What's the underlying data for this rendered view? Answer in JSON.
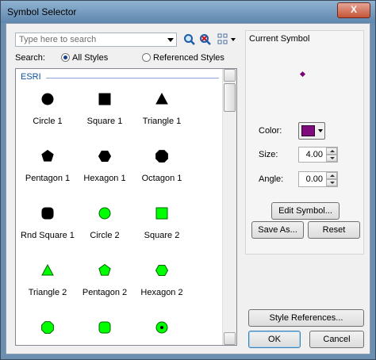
{
  "window": {
    "title": "Symbol Selector",
    "close_glyph": "X"
  },
  "search": {
    "placeholder": "Type here to search",
    "label": "Search:",
    "options": [
      "All Styles",
      "Referenced Styles"
    ],
    "selected": "All Styles"
  },
  "toolbar": {
    "icons": [
      "search-icon",
      "clear-search-icon",
      "view-options-icon"
    ]
  },
  "symbol_list": {
    "group": "ESRI",
    "symbols": [
      {
        "label": "Circle 1",
        "shape": "circle",
        "fill": "#000000"
      },
      {
        "label": "Square 1",
        "shape": "square",
        "fill": "#000000"
      },
      {
        "label": "Triangle 1",
        "shape": "triangle",
        "fill": "#000000"
      },
      {
        "label": "Pentagon 1",
        "shape": "pentagon",
        "fill": "#000000"
      },
      {
        "label": "Hexagon 1",
        "shape": "hexagon",
        "fill": "#000000"
      },
      {
        "label": "Octagon 1",
        "shape": "octagon",
        "fill": "#000000"
      },
      {
        "label": "Rnd Square 1",
        "shape": "rndsquare",
        "fill": "#000000"
      },
      {
        "label": "Circle 2",
        "shape": "circle",
        "fill": "#00ff00"
      },
      {
        "label": "Square 2",
        "shape": "square",
        "fill": "#00ff00"
      },
      {
        "label": "Triangle 2",
        "shape": "triangle",
        "fill": "#00ff00"
      },
      {
        "label": "Pentagon 2",
        "shape": "pentagon",
        "fill": "#00ff00"
      },
      {
        "label": "Hexagon 2",
        "shape": "hexagon",
        "fill": "#00ff00"
      },
      {
        "label": "",
        "shape": "octagon",
        "fill": "#00ff00"
      },
      {
        "label": "",
        "shape": "rndsquare",
        "fill": "#00ff00"
      },
      {
        "label": "",
        "shape": "targetcircle",
        "fill": "#00ff00"
      }
    ]
  },
  "current_symbol": {
    "title": "Current Symbol",
    "color_label": "Color:",
    "color": "#7e0a7e",
    "size_label": "Size:",
    "size": "4.00",
    "angle_label": "Angle:",
    "angle": "0.00",
    "edit_button": "Edit Symbol...",
    "save_as_button": "Save As...",
    "reset_button": "Reset"
  },
  "footer": {
    "style_references_button": "Style References...",
    "ok_button": "OK",
    "cancel_button": "Cancel"
  }
}
